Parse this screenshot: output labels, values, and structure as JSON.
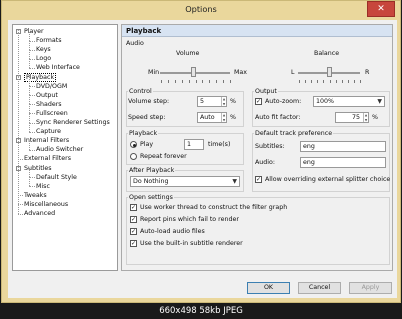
{
  "window": {
    "title": "Options",
    "close_icon": "close-icon"
  },
  "tree": {
    "items": [
      {
        "label": "Player",
        "level": 0,
        "expander": "-"
      },
      {
        "label": "Formats",
        "level": 1
      },
      {
        "label": "Keys",
        "level": 1
      },
      {
        "label": "Logo",
        "level": 1
      },
      {
        "label": "Web Interface",
        "level": 1
      },
      {
        "label": "Playback",
        "level": 0,
        "expander": "-",
        "selected": true
      },
      {
        "label": "DVD/OGM",
        "level": 1
      },
      {
        "label": "Output",
        "level": 1
      },
      {
        "label": "Shaders",
        "level": 1
      },
      {
        "label": "Fullscreen",
        "level": 1
      },
      {
        "label": "Sync Renderer Settings",
        "level": 1
      },
      {
        "label": "Capture",
        "level": 1
      },
      {
        "label": "Internal Filters",
        "level": 0,
        "expander": "-"
      },
      {
        "label": "Audio Switcher",
        "level": 1
      },
      {
        "label": "External Filters",
        "level": 0
      },
      {
        "label": "Subtitles",
        "level": 0,
        "expander": "-"
      },
      {
        "label": "Default Style",
        "level": 1
      },
      {
        "label": "Misc",
        "level": 1
      },
      {
        "label": "Tweaks",
        "level": 0
      },
      {
        "label": "Miscellaneous",
        "level": 0
      },
      {
        "label": "Advanced",
        "level": 0
      }
    ]
  },
  "panel": {
    "title": "Playback",
    "audio": {
      "group": "Audio",
      "volume": "Volume",
      "min": "Min",
      "max": "Max",
      "balance": "Balance",
      "l": "L",
      "r": "R",
      "volume_level": 0.48,
      "balance_level": 0.5
    },
    "control": {
      "group": "Control",
      "volume_step_label": "Volume step:",
      "volume_step": "5",
      "speed_step_label": "Speed step:",
      "speed_step": "Auto",
      "pct": "%"
    },
    "output": {
      "group": "Output",
      "autozoom_label": "Auto-zoom:",
      "autozoom_checked": true,
      "autozoom_value": "100%",
      "autofit_label": "Auto fit factor:",
      "autofit_value": "75",
      "pct": "%"
    },
    "playback": {
      "group": "Playback",
      "play": "Play",
      "times_value": "1",
      "times": "time(s)",
      "repeat": "Repeat forever",
      "play_selected": true
    },
    "after": {
      "group": "After Playback",
      "value": "Do Nothing"
    },
    "track": {
      "group": "Default track preference",
      "subtitles_label": "Subtitles:",
      "subtitles_value": "eng",
      "audio_label": "Audio:",
      "audio_value": "eng",
      "override_label": "Allow overriding external splitter choice",
      "override_checked": true
    },
    "open": {
      "group": "Open settings",
      "items": [
        {
          "label": "Use worker thread to construct the filter graph",
          "checked": true
        },
        {
          "label": "Report pins which fail to render",
          "checked": true
        },
        {
          "label": "Auto-load audio files",
          "checked": true
        },
        {
          "label": "Use the built-in subtitle renderer",
          "checked": true
        }
      ]
    }
  },
  "buttons": {
    "ok": "OK",
    "cancel": "Cancel",
    "apply": "Apply"
  },
  "footer": "660x498  58kb  JPEG"
}
